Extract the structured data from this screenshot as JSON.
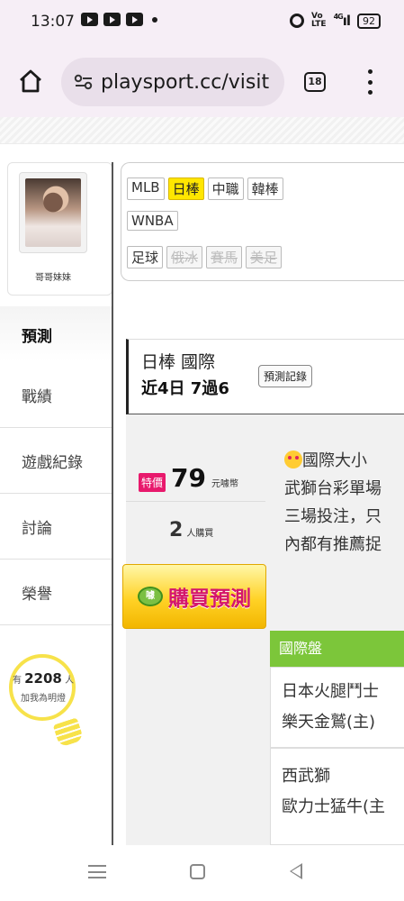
{
  "status_bar": {
    "time": "13:07",
    "battery": "92",
    "network": "4G"
  },
  "browser": {
    "url": "playsport.cc/visit",
    "tab_count": "18"
  },
  "profile": {
    "user_name": "哥哥妹妹"
  },
  "leagues": {
    "row1": [
      "MLB",
      "日棒",
      "中職",
      "韓棒"
    ],
    "row2": [
      "WNBA"
    ],
    "row3": [
      "足球",
      "俄冰",
      "賽馬",
      "美足"
    ],
    "active": "日棒"
  },
  "sidebar": {
    "items": [
      {
        "label": "預測"
      },
      {
        "label": "戰績"
      },
      {
        "label": "遊戲紀錄"
      },
      {
        "label": "討論"
      },
      {
        "label": "榮譽"
      }
    ]
  },
  "lightbulb": {
    "prefix": "有",
    "count": "2208",
    "suffix": "人",
    "line2": "加我為明燈"
  },
  "record": {
    "title": "日棒 國際",
    "stat": "近4日 7過6",
    "button": "預測記錄"
  },
  "offer": {
    "badge": "特價",
    "price": "79",
    "unit": "元噱幣",
    "buyers_count": "2",
    "buyers_label": "人購買",
    "buy_button": "購買預測",
    "coin_label": "噱"
  },
  "description": {
    "lines": [
      "國際大小",
      "武獅台彩單場",
      "三場投注，只",
      "內都有推薦捉"
    ]
  },
  "market": {
    "header": "國際盤",
    "matches": [
      {
        "away": "日本火腿鬥士",
        "home": "樂天金鷲(主)"
      },
      {
        "away": "西武獅",
        "home": "歐力士猛牛(主"
      }
    ]
  }
}
